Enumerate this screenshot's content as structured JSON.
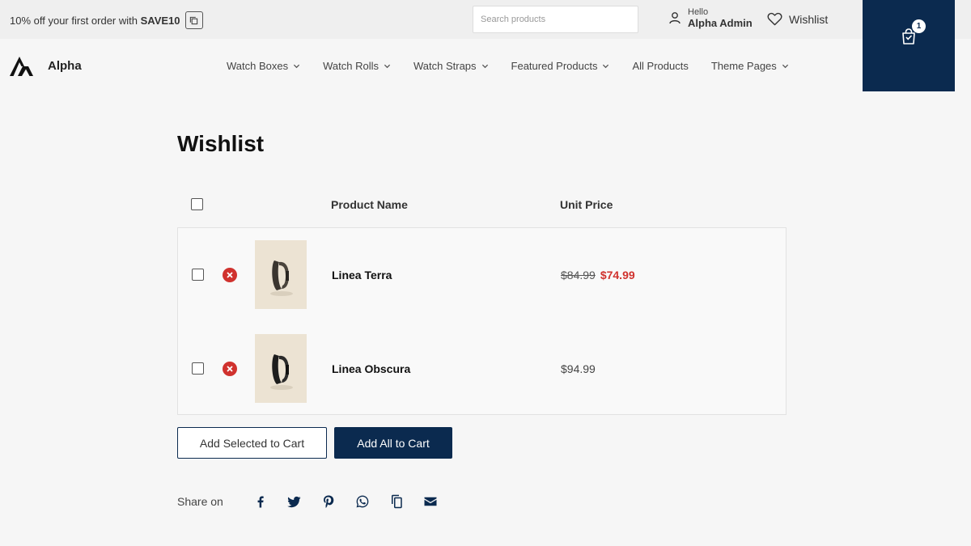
{
  "topbar": {
    "promo_text": "10% off your first order with ",
    "promo_code": "SAVE10",
    "search_placeholder": "Search products",
    "account_hello": "Hello",
    "account_name": "Alpha Admin",
    "wishlist_label": "Wishlist",
    "cart_count": "1"
  },
  "header": {
    "logo_text": "Alpha",
    "nav": [
      {
        "label": "Watch Boxes",
        "has_dropdown": true
      },
      {
        "label": "Watch Rolls",
        "has_dropdown": true
      },
      {
        "label": "Watch Straps",
        "has_dropdown": true
      },
      {
        "label": "Featured Products",
        "has_dropdown": true
      },
      {
        "label": "All Products",
        "has_dropdown": false
      },
      {
        "label": "Theme Pages",
        "has_dropdown": true
      }
    ]
  },
  "main": {
    "title": "Wishlist",
    "columns": {
      "name": "Product Name",
      "price": "Unit Price"
    },
    "items": [
      {
        "name": "Linea Terra",
        "old_price": "$84.99",
        "price": "$74.99",
        "on_sale": true
      },
      {
        "name": "Linea Obscura",
        "old_price": "",
        "price": "$94.99",
        "on_sale": false
      }
    ],
    "add_selected_label": "Add Selected to Cart",
    "add_all_label": "Add All to Cart",
    "share_label": "Share on",
    "share_icons": [
      "facebook-icon",
      "twitter-icon",
      "pinterest-icon",
      "whatsapp-icon",
      "copy-link-icon",
      "email-icon"
    ]
  },
  "colors": {
    "brand_navy": "#0b2a4f",
    "sale_red": "#d0322e",
    "background": "#f6f6f6"
  }
}
